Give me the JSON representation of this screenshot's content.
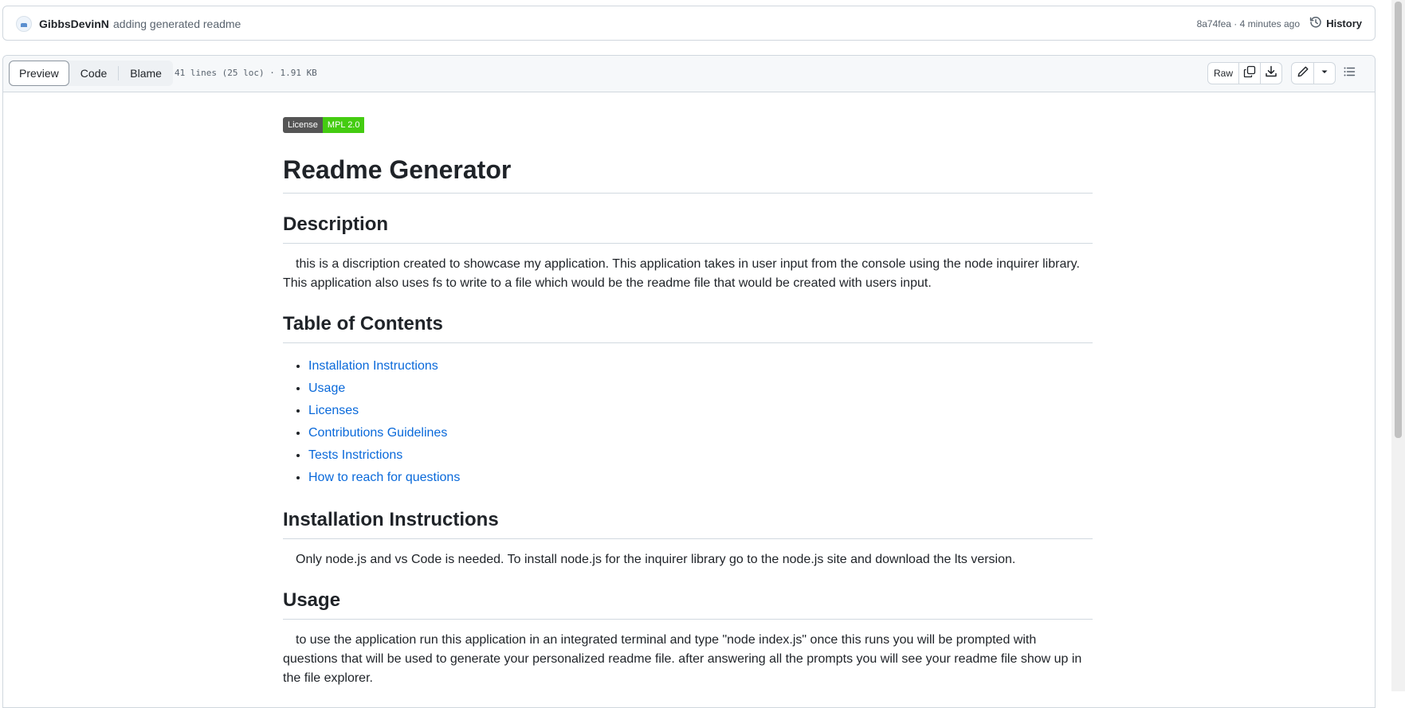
{
  "commit": {
    "author": "GibbsDevinN",
    "message": "adding generated readme",
    "meta": "8a74fea · 4 minutes ago",
    "history_label": "History"
  },
  "file_header": {
    "tabs": [
      "Preview",
      "Code",
      "Blame"
    ],
    "active_tab": "Preview",
    "info": "41 lines (25 loc) · 1.91 KB",
    "raw_label": "Raw"
  },
  "readme": {
    "badge": {
      "label": "License",
      "value": "MPL 2.0",
      "label_color": "#555555",
      "value_color": "#44cc11"
    },
    "title": "Readme Generator",
    "sections": {
      "description": {
        "heading": "Description",
        "text": "this is a discription created to showcase my application. This application takes in user input from the console using the node inquirer library. This application also uses fs to write to a file which would be the readme file that would be created with users input."
      },
      "toc": {
        "heading": "Table of Contents",
        "items": [
          "Installation Instructions",
          "Usage",
          "Licenses",
          "Contributions Guidelines",
          "Tests Instrictions",
          "How to reach for questions"
        ]
      },
      "installation": {
        "heading": "Installation Instructions",
        "text": "Only node.js and vs Code is needed. To install node.js for the inquirer library go to the node.js site and download the lts version."
      },
      "usage": {
        "heading": "Usage",
        "text": "to use the application run this application in an integrated terminal and type \"node index.js\" once this runs you will be prompted with questions that will be used to generate your personalized readme file. after answering all the prompts you will see your readme file show up in the file explorer."
      }
    }
  },
  "colors": {
    "link": "#0969da",
    "border": "#d0d7de",
    "text": "#1f2328",
    "muted": "#59636e"
  }
}
